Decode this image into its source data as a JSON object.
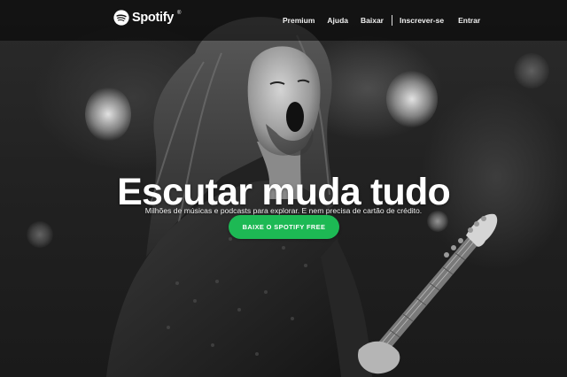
{
  "brand": {
    "name": "Spotify",
    "trademark": "®",
    "logo_icon": "spotify-logo-icon",
    "accent_color": "#1db954"
  },
  "nav": {
    "premium": "Premium",
    "help": "Ajuda",
    "download": "Baixar",
    "signup": "Inscrever-se",
    "login": "Entrar"
  },
  "hero": {
    "title": "Escutar muda tudo",
    "subtitle": "Milhões de músicas e podcasts para explorar. E nem precisa de cartão de crédito.",
    "cta_label": "BAIXE O SPOTIFY FREE",
    "background": "black-and-white photo of a long-haired guitarist singing on stage"
  }
}
